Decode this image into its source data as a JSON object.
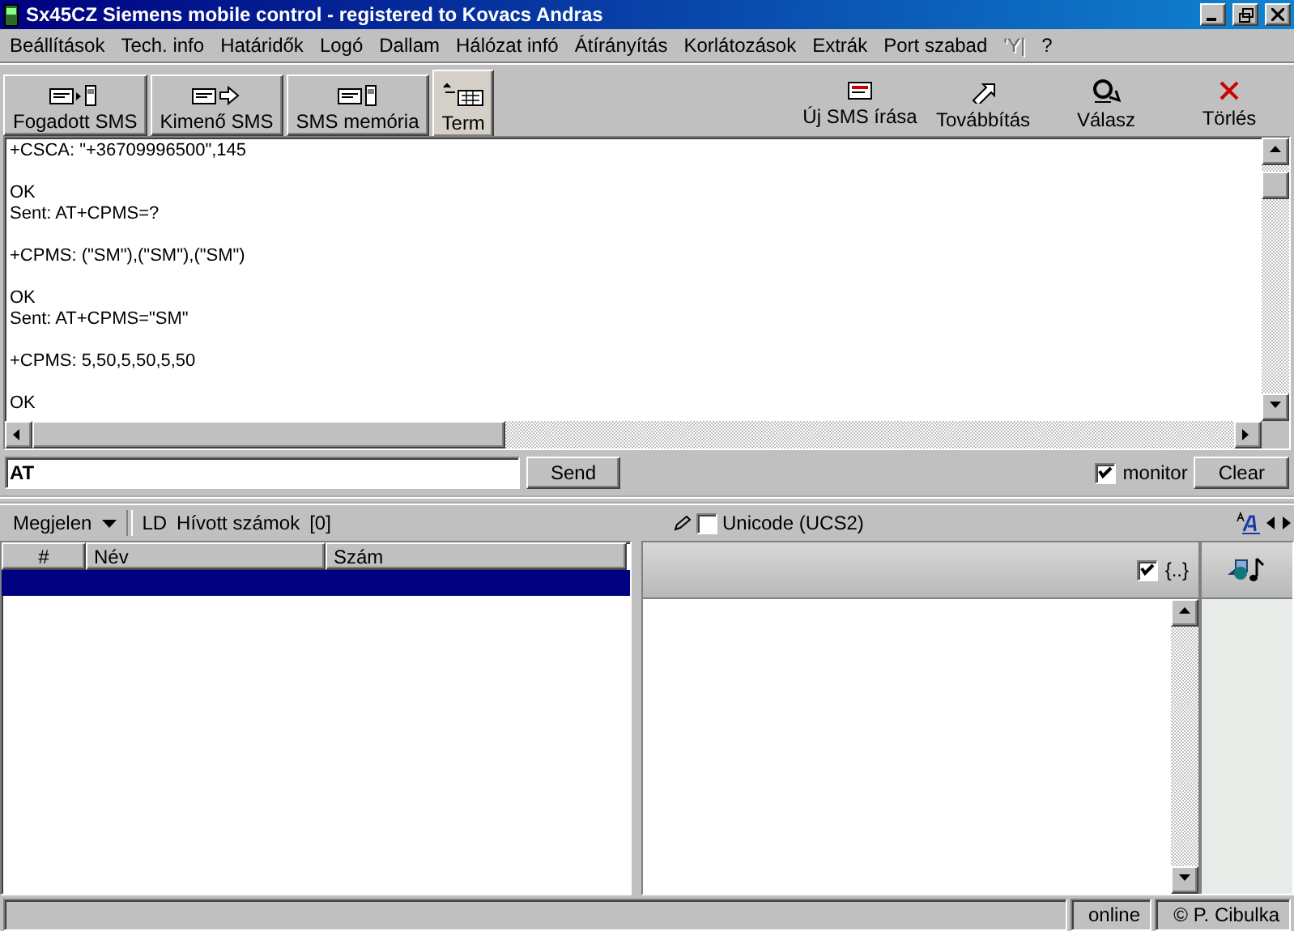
{
  "window": {
    "title": "Sx45CZ Siemens mobile control - registered to  Kovacs Andras"
  },
  "menu": [
    {
      "label": "Beállítások",
      "disabled": false
    },
    {
      "label": "Tech. info",
      "disabled": false
    },
    {
      "label": "Határidők",
      "disabled": false
    },
    {
      "label": "Logó",
      "disabled": false
    },
    {
      "label": "Dallam",
      "disabled": false
    },
    {
      "label": "Hálózat infó",
      "disabled": false
    },
    {
      "label": "Átírányítás",
      "disabled": false
    },
    {
      "label": "Korlátozások",
      "disabled": false
    },
    {
      "label": "Extrák",
      "disabled": false
    },
    {
      "label": "Port szabad",
      "disabled": false
    },
    {
      "label": "'Y|",
      "disabled": true
    },
    {
      "label": "?",
      "disabled": false
    }
  ],
  "tabs": [
    {
      "label": "Fogadott SMS",
      "kind": "inbox",
      "selected": false
    },
    {
      "label": "Kimenő SMS",
      "kind": "outbox",
      "selected": false
    },
    {
      "label": "SMS memória",
      "kind": "memory",
      "selected": false
    },
    {
      "label": "Term",
      "kind": "terminal",
      "selected": true
    }
  ],
  "actions": [
    {
      "label": "Új SMS írása",
      "kind": "compose"
    },
    {
      "label": "Továbbítás",
      "kind": "forward"
    },
    {
      "label": "Válasz",
      "kind": "reply"
    },
    {
      "label": "Törlés",
      "kind": "delete"
    }
  ],
  "terminal": {
    "blocks": [
      [
        "+CSCA: \"+36709996500\",145"
      ],
      [
        "OK",
        "Sent: AT+CPMS=?"
      ],
      [
        "+CPMS: (\"SM\"),(\"SM\"),(\"SM\")"
      ],
      [
        "OK",
        "Sent: AT+CPMS=\"SM\""
      ],
      [
        "+CPMS: 5,50,5,50,5,50"
      ],
      [
        "OK"
      ]
    ]
  },
  "command": {
    "value": "AT",
    "send": "Send",
    "monitor": {
      "label": "monitor",
      "checked": true
    },
    "clear": "Clear"
  },
  "list_panel": {
    "view_menu": "Megjelen",
    "source": "LD",
    "title": "Hívott számok",
    "count": "[0]",
    "columns": [
      "#",
      "Név",
      "Szám"
    ]
  },
  "editor_panel": {
    "unicode": {
      "label": "Unicode (UCS2)",
      "checked": false
    },
    "brackets": {
      "label": "{..}",
      "checked": true
    }
  },
  "status_bar": {
    "connection": "online",
    "credit": "© P. Cibulka"
  }
}
